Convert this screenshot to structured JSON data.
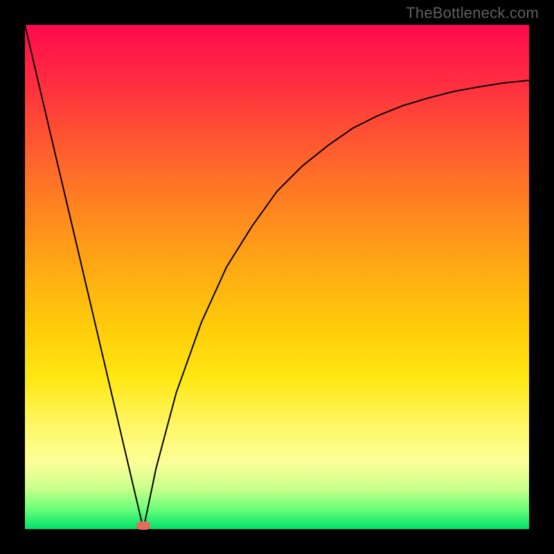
{
  "watermark": "TheBottleneck.com",
  "colors": {
    "frame": "#000000",
    "gradient_top": "#ff0a4e",
    "gradient_bottom": "#00e26a",
    "curve": "#000000",
    "marker": "#e8695d"
  },
  "chart_data": {
    "type": "line",
    "title": "",
    "xlabel": "",
    "ylabel": "",
    "xlim": [
      0,
      100
    ],
    "ylim": [
      0,
      100
    ],
    "series": [
      {
        "name": "left-branch",
        "x": [
          0,
          5,
          10,
          15,
          20,
          23.5
        ],
        "y": [
          100,
          78.7,
          57.5,
          36.2,
          14.9,
          0
        ]
      },
      {
        "name": "right-branch",
        "x": [
          23.5,
          26,
          30,
          35,
          40,
          45,
          50,
          55,
          60,
          65,
          70,
          75,
          80,
          85,
          90,
          95,
          100
        ],
        "y": [
          0,
          12,
          27,
          41,
          52,
          60,
          67,
          72,
          76,
          79.5,
          82,
          84,
          85.5,
          86.8,
          87.7,
          88.5,
          89
        ]
      }
    ],
    "marker": {
      "x": 23.5,
      "y": 0.7
    },
    "grid": false,
    "legend": false
  }
}
